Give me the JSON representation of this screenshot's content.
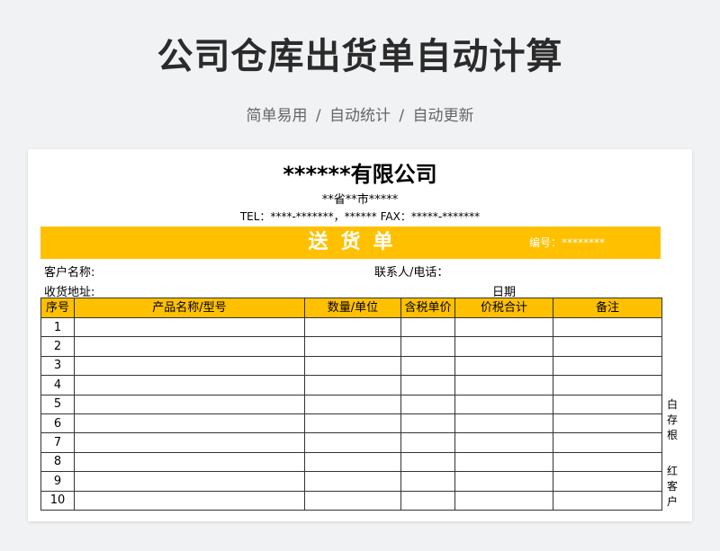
{
  "header": {
    "title": "公司仓库出货单自动计算",
    "subtitle": "简单易用 / 自动统计 / 自动更新"
  },
  "form": {
    "company": "******有限公司",
    "address": "**省**市*****",
    "contact": "TEL：****-*******，****** FAX：*****-*******",
    "banner_title": "送货单",
    "number_label": "编号：********",
    "customer_label": "客户名称:",
    "contact_person_label": "联系人/电话：",
    "address_label": "收货地址:",
    "date_label": "日期"
  },
  "table": {
    "headers": [
      "序号",
      "产品名称/型号",
      "数量/单位",
      "含税单价",
      "价税合计",
      "备注"
    ],
    "rows": [
      "1",
      "2",
      "3",
      "4",
      "5",
      "6",
      "7",
      "8",
      "9",
      "10"
    ]
  },
  "side_notes": {
    "top": [
      "白",
      "存",
      "根"
    ],
    "bottom": [
      "红",
      "客",
      "户"
    ]
  }
}
